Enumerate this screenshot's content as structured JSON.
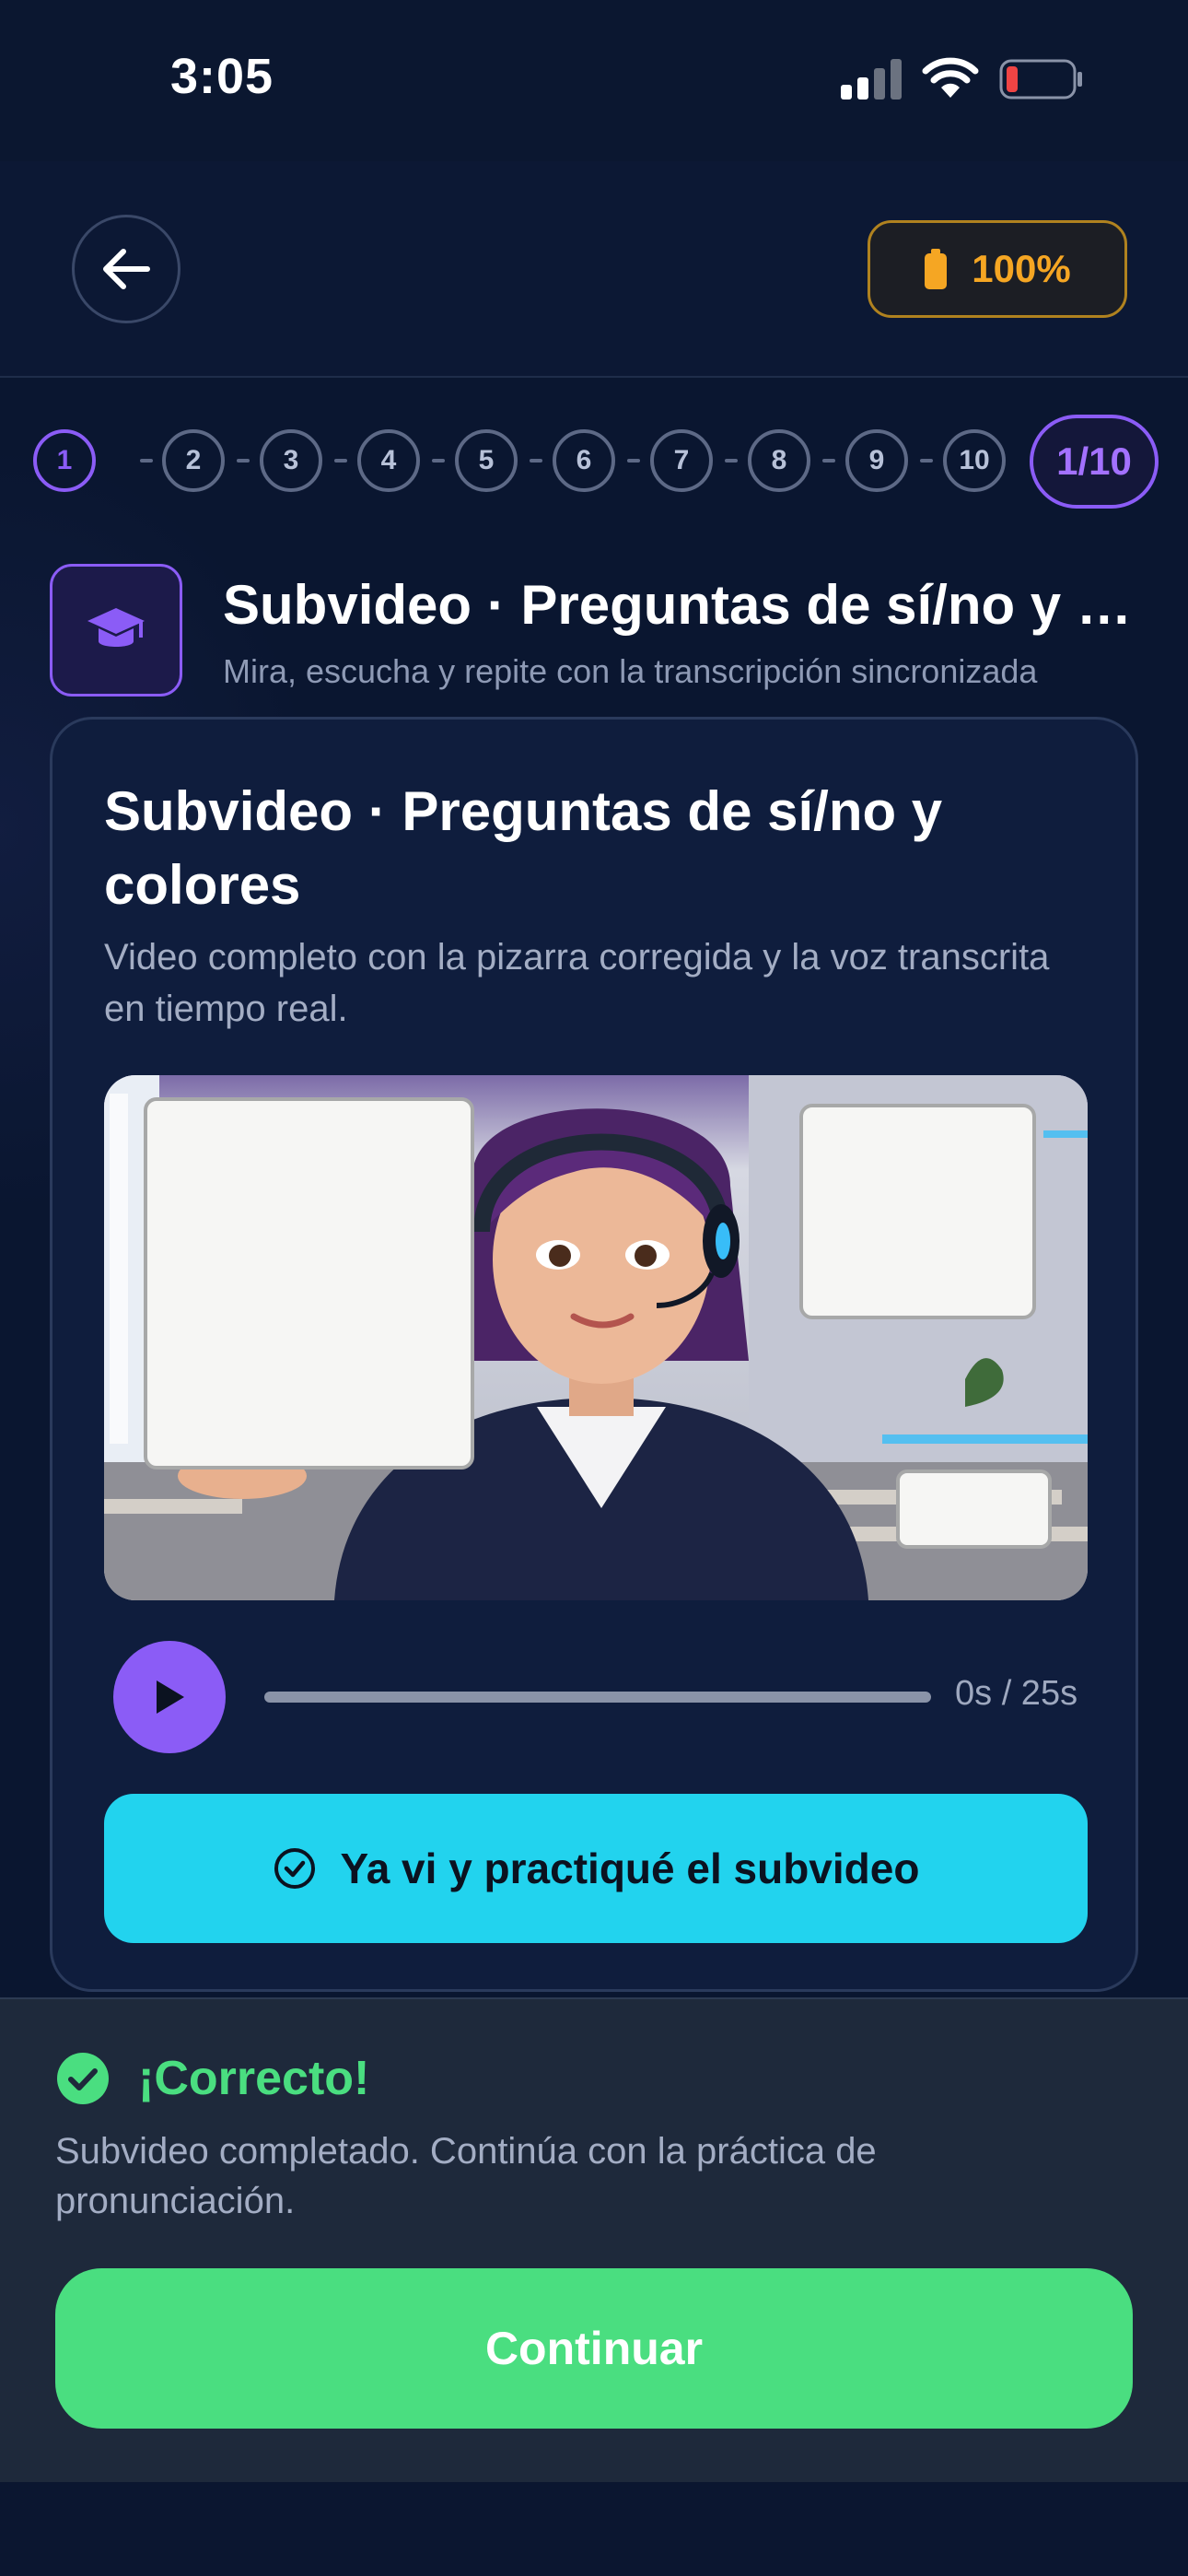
{
  "status_bar": {
    "time": "3:05"
  },
  "header": {
    "back_icon": "arrow-left-icon",
    "energy_icon": "battery-icon",
    "energy_value": "100%"
  },
  "progress": {
    "steps": [
      "1",
      "2",
      "3",
      "4",
      "5",
      "6",
      "7",
      "8",
      "9",
      "10"
    ],
    "current": 1,
    "counter": "1/10"
  },
  "lesson": {
    "icon": "graduation-cap-icon",
    "title": "Subvideo · Preguntas de sí/no y colores",
    "subtitle": "Mira, escucha y repite con la transcripción sincronizada"
  },
  "card": {
    "title": "Subvideo · Preguntas de sí/no y colores",
    "description": "Video completo con la pizarra corregida y la voz transcrita en tiempo real.",
    "player": {
      "play_icon": "play-icon",
      "time": "0s / 25s",
      "progress": 0
    },
    "practice_button": "Ya vi y practiqué el subvideo",
    "practice_icon": "check-circle-icon"
  },
  "feedback": {
    "icon": "check-circle-filled-icon",
    "title": "¡Correcto!",
    "message": "Subvideo completado. Continúa con la práctica de pronunciación.",
    "continue_label": "Continuar"
  },
  "colors": {
    "accent_purple": "#8b5cf6",
    "cyan": "#22d3ee",
    "success_green": "#4ade80",
    "energy_orange": "#f5a623",
    "background": "#0a1630"
  }
}
